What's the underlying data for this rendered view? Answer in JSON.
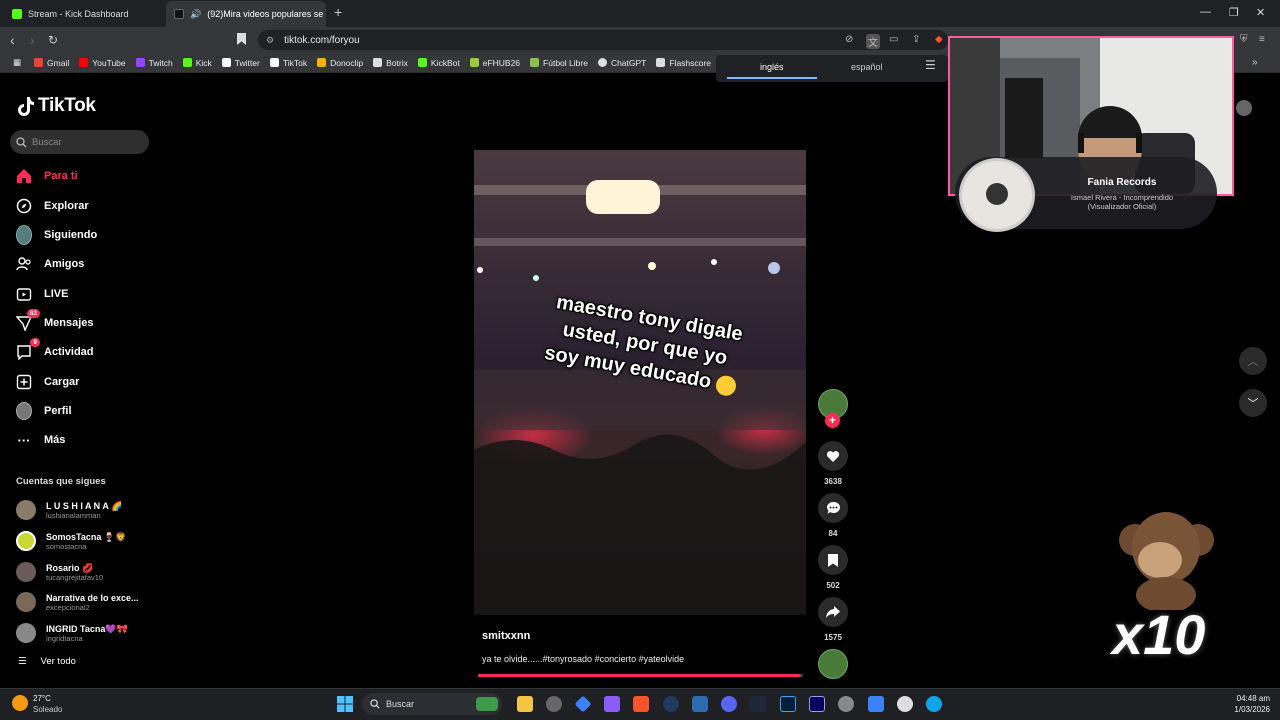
{
  "browser": {
    "tabs": [
      {
        "title": "Stream - Kick Dashboard",
        "active": false
      },
      {
        "title": "(92)Mira videos populares se",
        "active": true
      }
    ],
    "url": "tiktok.com/foryou",
    "bookmarks": [
      {
        "label": "Gmail",
        "color": "#ea4335"
      },
      {
        "label": "YouTube",
        "color": "#ff0000"
      },
      {
        "label": "Twitch",
        "color": "#9146ff"
      },
      {
        "label": "Kick",
        "color": "#53fc18"
      },
      {
        "label": "Twitter",
        "color": "#ffffff"
      },
      {
        "label": "TikTok",
        "color": "#ffffff"
      },
      {
        "label": "Donoclip",
        "color": "#f4b400"
      },
      {
        "label": "Botrix",
        "color": "#dddddd"
      },
      {
        "label": "KickBot",
        "color": "#53fc18"
      },
      {
        "label": "eFHUB26",
        "color": "#9acd32"
      },
      {
        "label": "Fútbol Libre",
        "color": "#8bc34a"
      },
      {
        "label": "ChatGPT",
        "color": "#dddddd"
      },
      {
        "label": "Flashscore",
        "color": "#dddddd"
      }
    ],
    "translate": {
      "from": "inglés",
      "to": "español"
    }
  },
  "tiktok": {
    "logo": "TikTok",
    "search_placeholder": "Buscar",
    "nav": [
      {
        "label": "Para ti",
        "icon": "home-icon",
        "active": true,
        "badge": ""
      },
      {
        "label": "Explorar",
        "icon": "compass-icon",
        "active": false,
        "badge": ""
      },
      {
        "label": "Siguiendo",
        "icon": "following-avatar-icon",
        "active": false,
        "badge": ""
      },
      {
        "label": "Amigos",
        "icon": "friends-icon",
        "active": false,
        "badge": ""
      },
      {
        "label": "LIVE",
        "icon": "live-icon",
        "active": false,
        "badge": ""
      },
      {
        "label": "Mensajes",
        "icon": "messages-icon",
        "active": false,
        "badge": "83"
      },
      {
        "label": "Actividad",
        "icon": "activity-icon",
        "active": false,
        "badge": "9"
      },
      {
        "label": "Cargar",
        "icon": "upload-icon",
        "active": false,
        "badge": ""
      },
      {
        "label": "Perfil",
        "icon": "profile-avatar-icon",
        "active": false,
        "badge": ""
      },
      {
        "label": "Más",
        "icon": "more-icon",
        "active": false,
        "badge": ""
      }
    ],
    "following_title": "Cuentas que sigues",
    "following": [
      {
        "name": "L U S H I A N A 🌈",
        "handle": "lushianalamman",
        "color": "#8a7a6a"
      },
      {
        "name": "SomosTacna 🍷🦁",
        "handle": "somostacna",
        "color": "#c8d830"
      },
      {
        "name": "Rosario 💋",
        "handle": "tucangrejitafav10",
        "color": "#6a5a5a"
      },
      {
        "name": "Narrativa de lo exce...",
        "handle": "excepcional2",
        "color": "#7a6858"
      },
      {
        "name": "INGRID Tacna💜🎀",
        "handle": "ingridtacna",
        "color": "#888888"
      }
    ],
    "see_all": "Ver todo",
    "video": {
      "caption_lines": [
        "maestro tony digale",
        "usted, por que yo",
        "soy muy educado"
      ],
      "author": "smitxxnn",
      "description": "ya te olvide......#tonyrosado #concierto #yateolvide",
      "progress": 0.99
    },
    "actions": {
      "likes": "3638",
      "comments": "84",
      "saves": "502",
      "shares": "1575"
    }
  },
  "overlay": {
    "music_title": "Fania Records",
    "music_subtitle_1": "Ismael Rivera - Incomprendido",
    "music_subtitle_2": "(Visualizador Oficial)",
    "multiplier": "x10"
  },
  "taskbar": {
    "temperature": "27°C",
    "weather": "Soleado",
    "search_label": "Buscar",
    "time": "04:48 am",
    "date": "1/03/2026"
  }
}
